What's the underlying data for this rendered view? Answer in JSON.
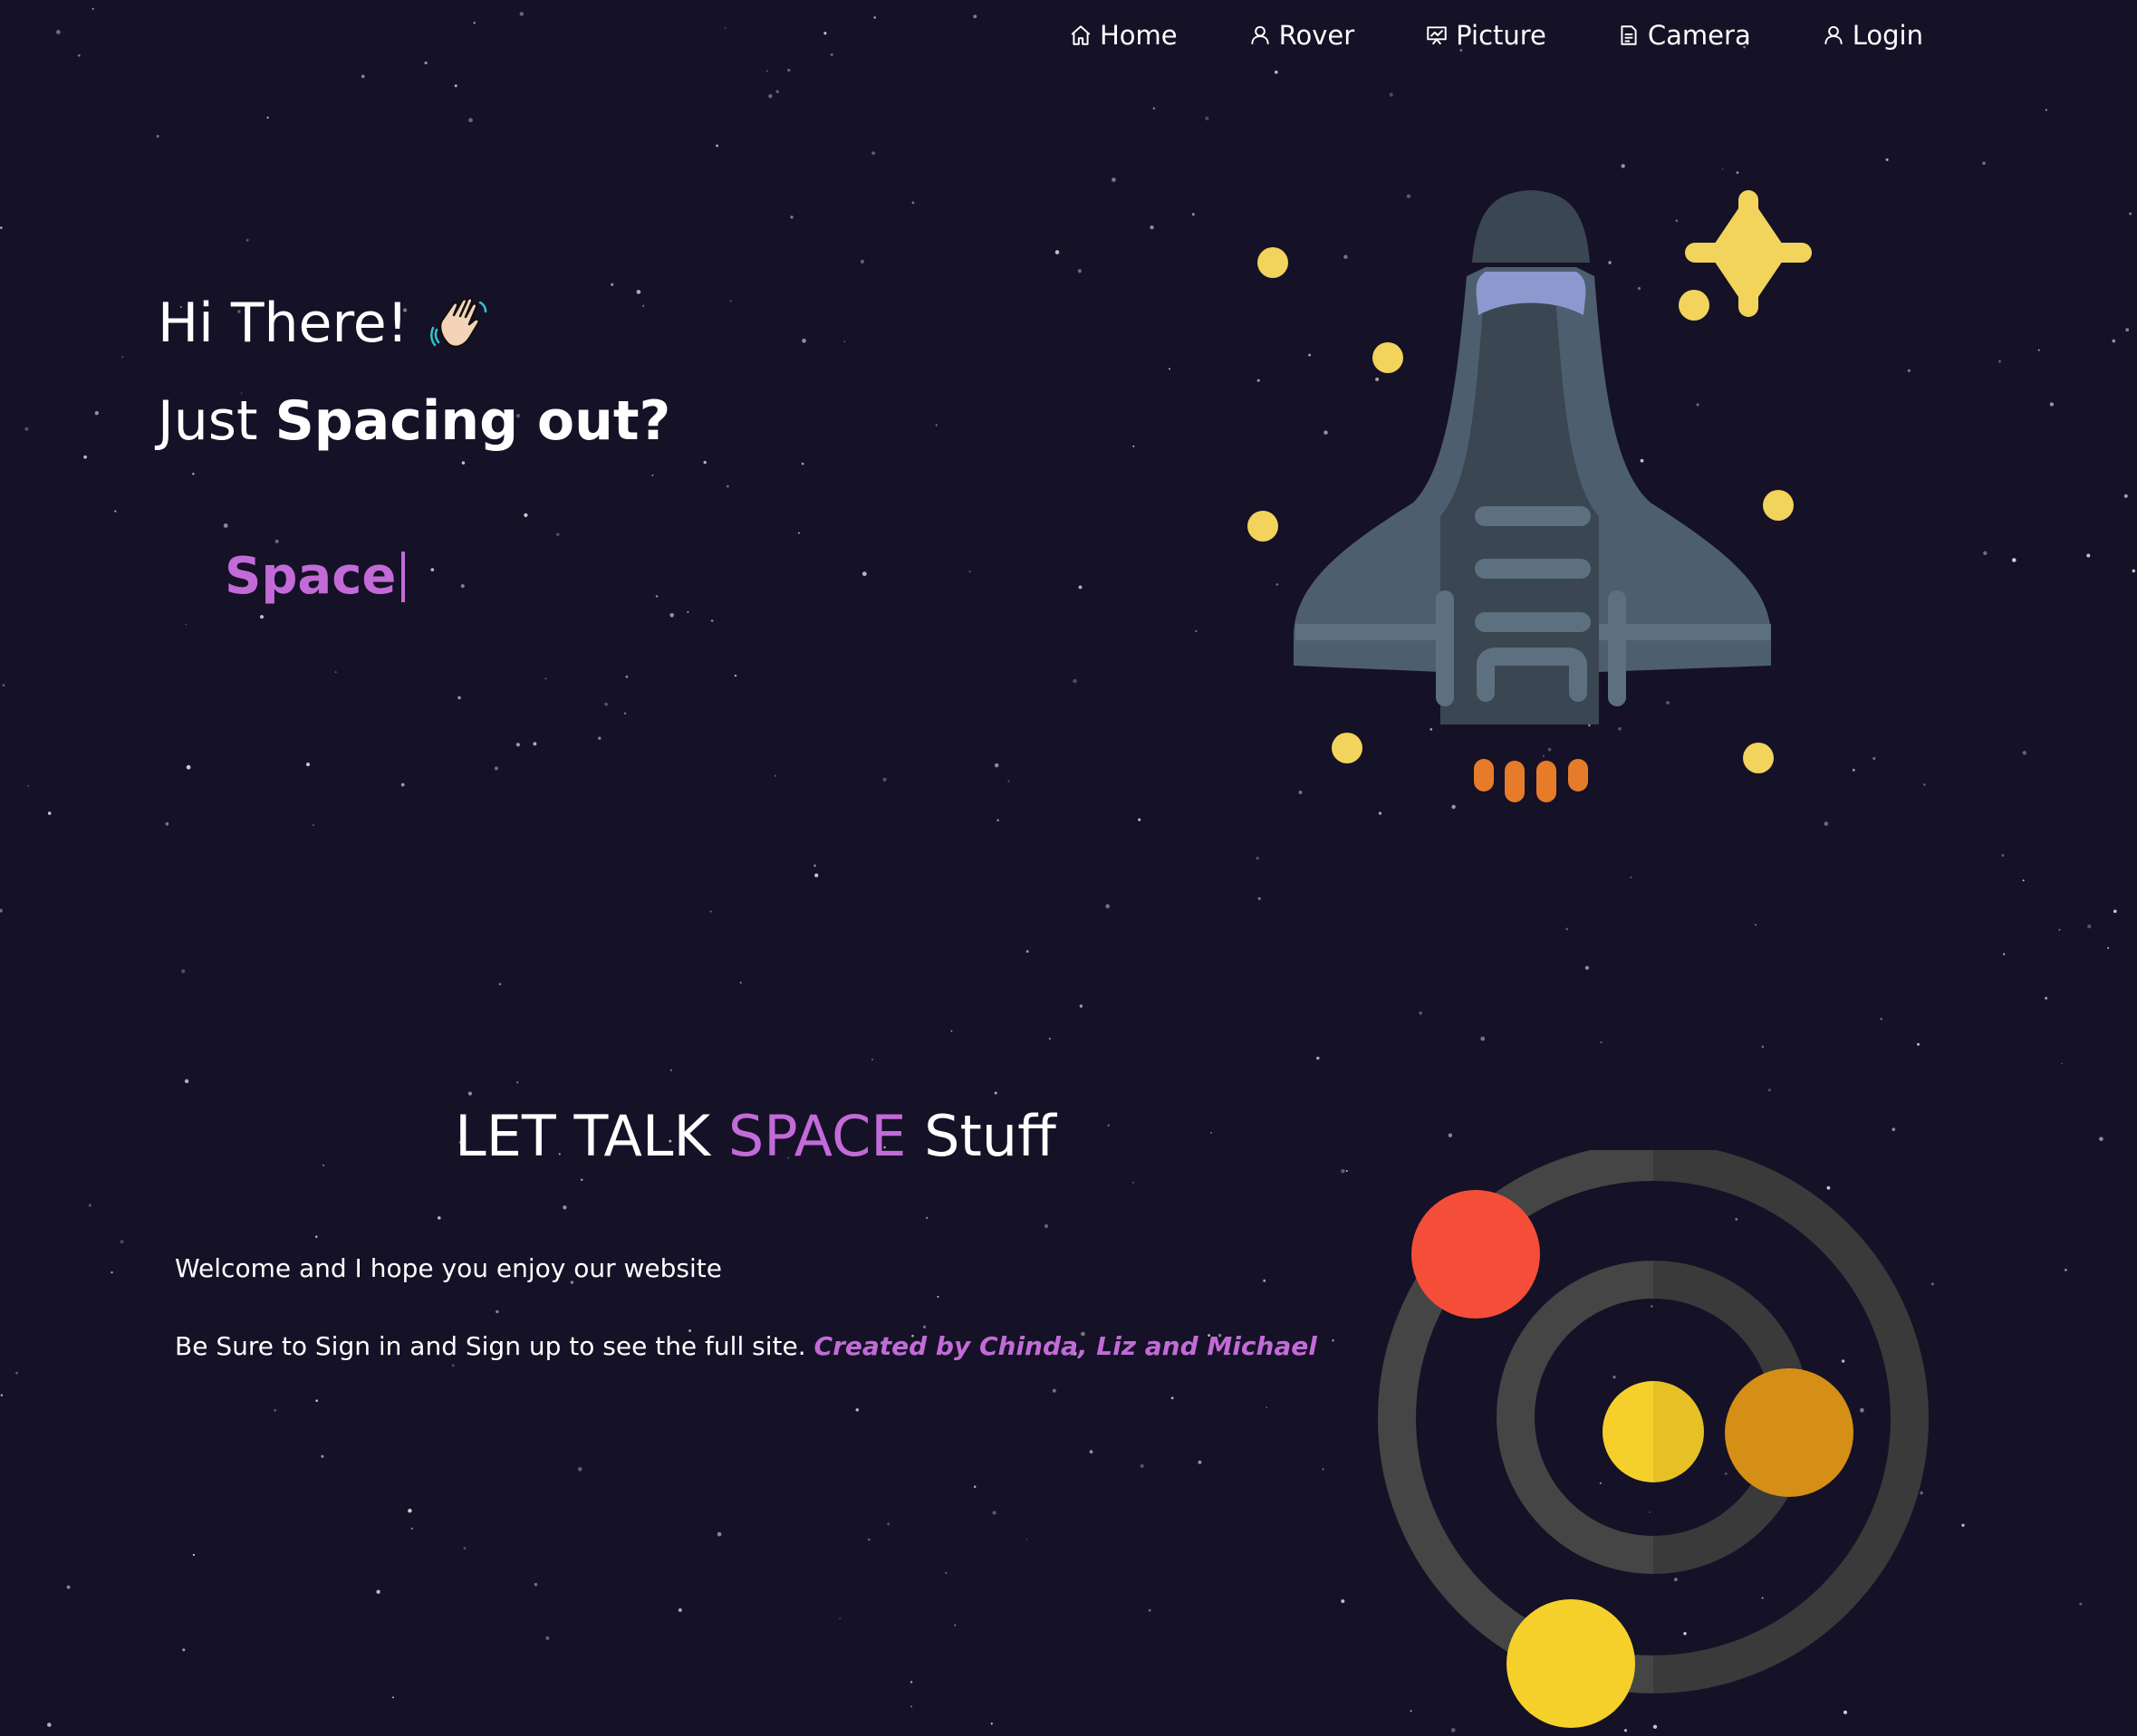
{
  "nav": {
    "items": [
      {
        "label": "Home",
        "icon": "home-icon"
      },
      {
        "label": "Rover",
        "icon": "user-icon"
      },
      {
        "label": "Picture",
        "icon": "presentation-icon"
      },
      {
        "label": "Camera",
        "icon": "document-icon"
      },
      {
        "label": "Login",
        "icon": "user-icon"
      }
    ]
  },
  "hero": {
    "greeting": "Hi There!",
    "greeting_icon": "waving-hand-icon",
    "subtitle_plain": "Just",
    "subtitle_bold": "Spacing out?",
    "typing_text": "Space"
  },
  "about": {
    "title_pre": "LET TALK",
    "title_accent": "SPACE",
    "title_post": "Stuff",
    "line1": "Welcome and I hope you enjoy our website",
    "line2": "Be Sure to Sign in and Sign up to see the full site.",
    "credits": "Created by Chinda, Liz and Michael"
  },
  "colors": {
    "background": "#151126",
    "accent": "#c26bd8",
    "text": "#ffffff",
    "star_yellow": "#f2d35b",
    "planet_red": "#f54e38",
    "planet_orange": "#d58f16",
    "sun_yellow": "#f6d02a"
  }
}
